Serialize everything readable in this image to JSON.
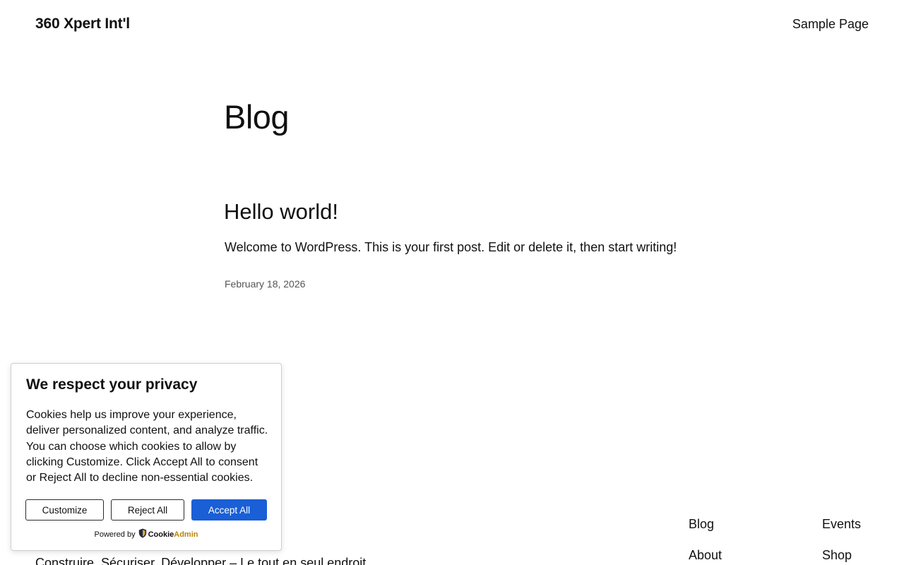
{
  "header": {
    "site_title": "360 Xpert Int'l",
    "nav": [
      {
        "label": "Sample Page"
      }
    ]
  },
  "main": {
    "page_title": "Blog",
    "posts": [
      {
        "title": "Hello world!",
        "excerpt": "Welcome to WordPress. This is your first post. Edit or delete it, then start writing!",
        "date": "February 18, 2026"
      }
    ]
  },
  "footer": {
    "tagline": "Construire. Sécuriser. Développer – Le tout en seul endroit",
    "links": [
      {
        "label": "Blog"
      },
      {
        "label": "About"
      },
      {
        "label": "Events"
      },
      {
        "label": "Shop"
      }
    ]
  },
  "cookie_banner": {
    "title": "We respect your privacy",
    "text": "Cookies help us improve your experience, deliver personalized content, and analyze traffic. You can choose which cookies to allow by clicking Customize. Click Accept All to consent or Reject All to decline non-essential cookies.",
    "buttons": {
      "customize": "Customize",
      "reject": "Reject All",
      "accept": "Accept All"
    },
    "powered_by": "Powered by",
    "brand_part1": "Cookie",
    "brand_part2": "Admin",
    "colors": {
      "accept": "#1a5fd6",
      "brand_accent": "#b8860b"
    },
    "icon": "shield-icon"
  }
}
